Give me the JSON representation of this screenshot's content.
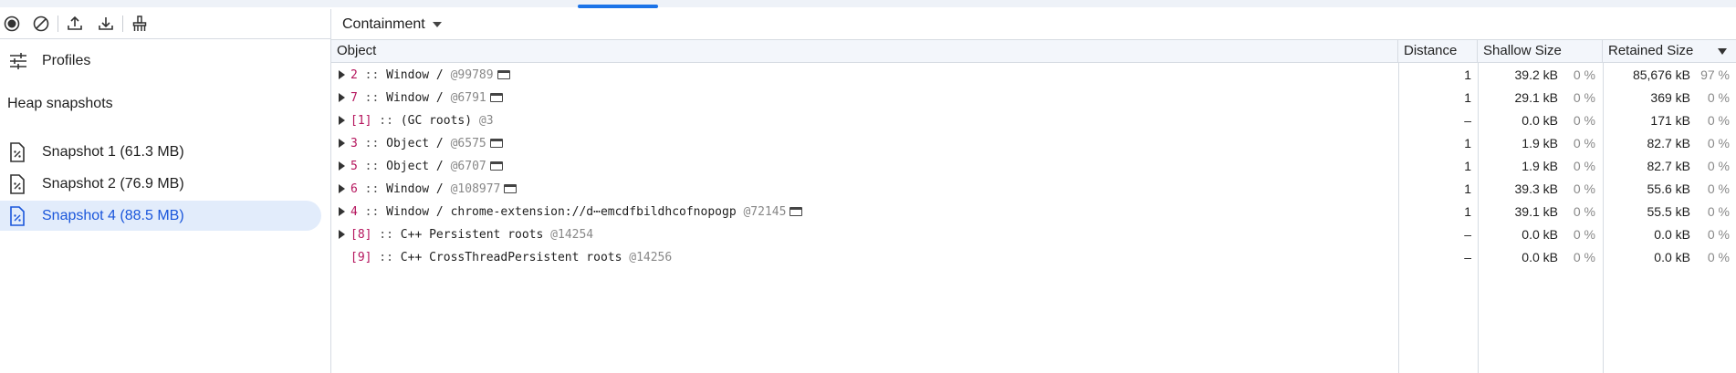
{
  "colors": {
    "accent": "#1a73e8",
    "selection_bg": "#e2ecfb",
    "object_id": "#b5155d"
  },
  "left_toolbar": {
    "icons": [
      "record-icon",
      "clear-icon",
      "upload-icon",
      "download-icon",
      "garbage-collect-icon"
    ]
  },
  "sidebar": {
    "profiles_label": "Profiles",
    "heap_header": "Heap snapshots",
    "snapshots": [
      {
        "label": "Snapshot 1 (61.3 MB)",
        "selected": false
      },
      {
        "label": "Snapshot 2 (76.9 MB)",
        "selected": false
      },
      {
        "label": "Snapshot 4 (88.5 MB)",
        "selected": true
      }
    ]
  },
  "view_selector": {
    "value": "Containment"
  },
  "table": {
    "headers": {
      "object": "Object",
      "distance": "Distance",
      "shallow": "Shallow Size",
      "retained": "Retained Size"
    },
    "sort": "retained-desc",
    "rows": [
      {
        "id": "2",
        "sep": " :: ",
        "name": "Window / ",
        "addr": "@99789",
        "window": true,
        "expandable": true,
        "distance": "1",
        "shallow": "39.2 kB",
        "shallow_pct": "0 %",
        "retained": "85,676 kB",
        "retained_pct": "97 %"
      },
      {
        "id": "7",
        "sep": " :: ",
        "name": "Window / ",
        "addr": "@6791",
        "window": true,
        "expandable": true,
        "distance": "1",
        "shallow": "29.1 kB",
        "shallow_pct": "0 %",
        "retained": "369 kB",
        "retained_pct": "0 %"
      },
      {
        "id": "[1]",
        "sep": " :: ",
        "name": "(GC roots) ",
        "addr": "@3",
        "window": false,
        "expandable": true,
        "distance": "–",
        "shallow": "0.0 kB",
        "shallow_pct": "0 %",
        "retained": "171 kB",
        "retained_pct": "0 %"
      },
      {
        "id": "3",
        "sep": " :: ",
        "name": "Object / ",
        "addr": "@6575",
        "window": true,
        "expandable": true,
        "distance": "1",
        "shallow": "1.9 kB",
        "shallow_pct": "0 %",
        "retained": "82.7 kB",
        "retained_pct": "0 %"
      },
      {
        "id": "5",
        "sep": " :: ",
        "name": "Object / ",
        "addr": "@6707",
        "window": true,
        "expandable": true,
        "distance": "1",
        "shallow": "1.9 kB",
        "shallow_pct": "0 %",
        "retained": "82.7 kB",
        "retained_pct": "0 %"
      },
      {
        "id": "6",
        "sep": " :: ",
        "name": "Window / ",
        "addr": "@108977",
        "window": true,
        "expandable": true,
        "distance": "1",
        "shallow": "39.3 kB",
        "shallow_pct": "0 %",
        "retained": "55.6 kB",
        "retained_pct": "0 %"
      },
      {
        "id": "4",
        "sep": " :: ",
        "name": "Window / chrome-extension://d⋯emcdfbildhcofnopogp ",
        "addr": "@72145",
        "window": true,
        "expandable": true,
        "distance": "1",
        "shallow": "39.1 kB",
        "shallow_pct": "0 %",
        "retained": "55.5 kB",
        "retained_pct": "0 %"
      },
      {
        "id": "[8]",
        "sep": " :: ",
        "name": "C++ Persistent roots ",
        "addr": "@14254",
        "window": false,
        "expandable": true,
        "distance": "–",
        "shallow": "0.0 kB",
        "shallow_pct": "0 %",
        "retained": "0.0 kB",
        "retained_pct": "0 %"
      },
      {
        "id": "[9]",
        "sep": " :: ",
        "name": "C++ CrossThreadPersistent roots ",
        "addr": "@14256",
        "window": false,
        "expandable": false,
        "distance": "–",
        "shallow": "0.0 kB",
        "shallow_pct": "0 %",
        "retained": "0.0 kB",
        "retained_pct": "0 %"
      }
    ]
  }
}
